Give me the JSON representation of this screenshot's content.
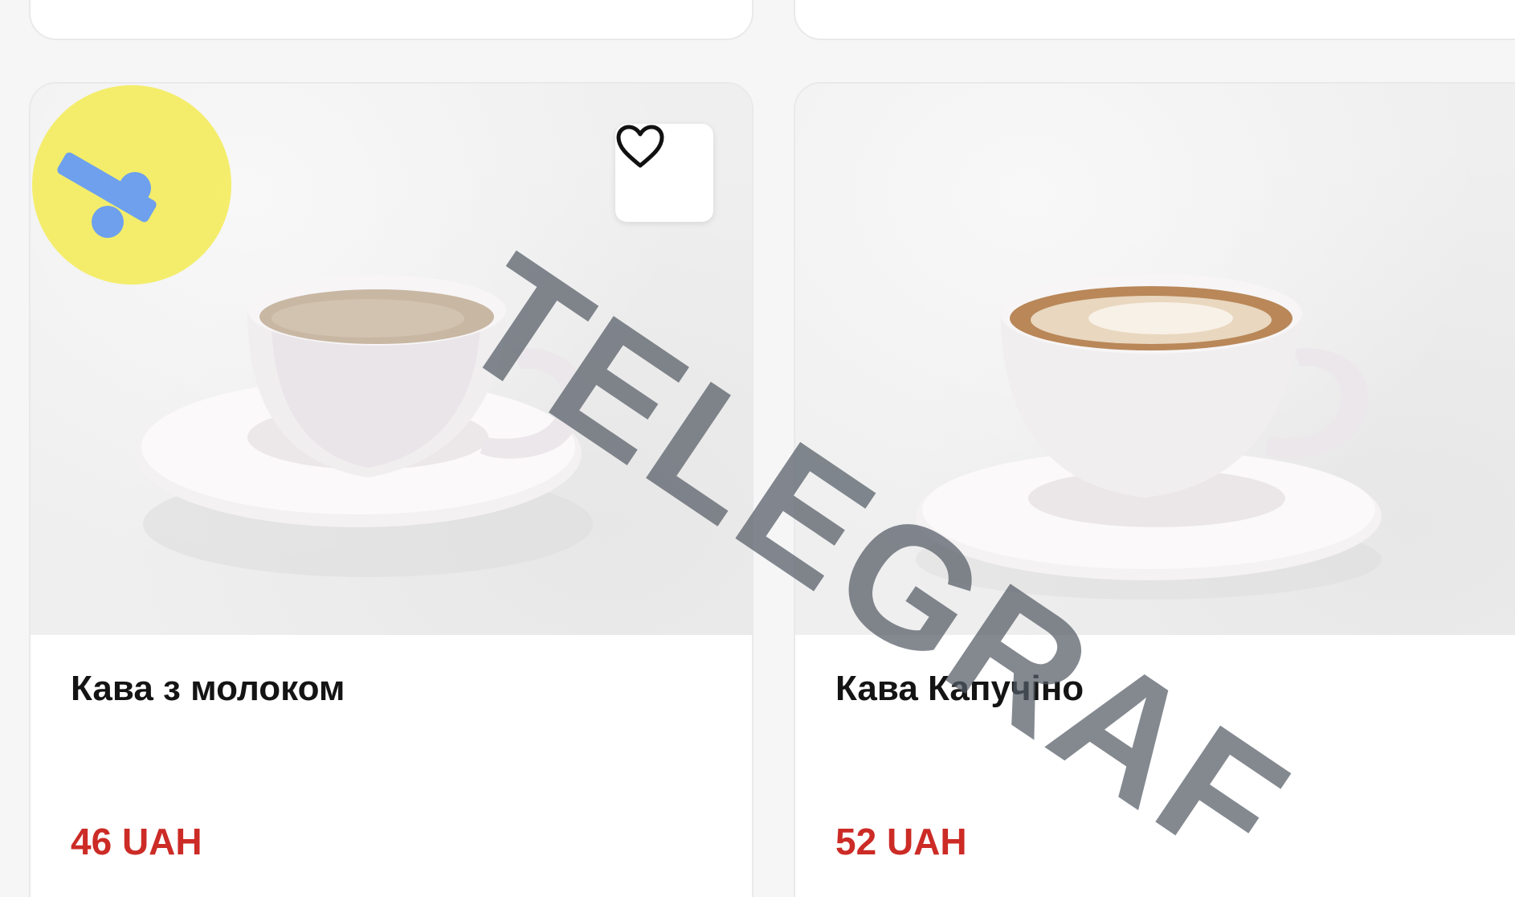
{
  "products": [
    {
      "name": "Кава з молоком",
      "price": "46 UAH",
      "favorite_icon": "heart-outline-icon"
    },
    {
      "name": "Кава Капучіно",
      "price": "52 UAH"
    }
  ],
  "watermark": {
    "text": "TELEGRAF",
    "logo_color": "#f4ec58",
    "logo_mark_color": "#6ea0ee"
  },
  "colors": {
    "price": "#cc2b26",
    "card_border": "#e9e9ec"
  }
}
